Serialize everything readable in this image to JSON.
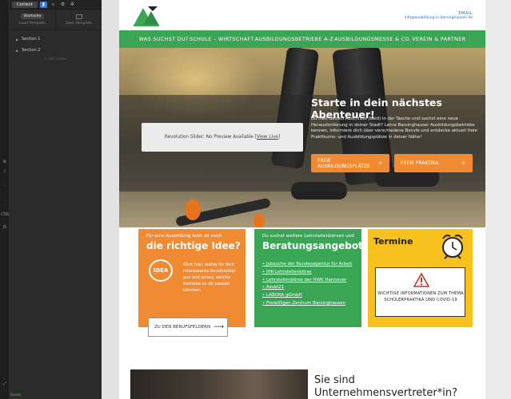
{
  "editor": {
    "tabs": [
      {
        "label": "Content"
      }
    ],
    "starter_label": "Startseite",
    "load_template": "Load Template",
    "save_template": "Save Template",
    "sections": [
      {
        "label": "Section 1"
      },
      {
        "label": "Section 2"
      }
    ],
    "add_section": "+ Add Section",
    "rail_labels": {
      "css": "CSS",
      "js": "JS"
    },
    "bottom_label": "Saves"
  },
  "site": {
    "email_label": "EMAIL",
    "email_value": "info@ausbildung-in-barsinghausen.de",
    "nav": [
      {
        "label": "WAS SUCHST DU?"
      },
      {
        "label": "SCHULE – WIRTSCHAFT"
      },
      {
        "label": "AUSBILDUNGSBETRIEBE A-Z"
      },
      {
        "label": "AUSBILDUNGSMESSE & CO."
      },
      {
        "label": "VEREIN & PARTNER"
      }
    ],
    "hero": {
      "title": "Starte in dein nächstes Abenteuer!",
      "body": "Du hast deinen Abschluss (bald) in der Tasche und suchst eine neue Herausforderung in deiner Stadt? Lerne Barsinghauser Ausbildungsbetriebe kennen, informiere dich über verschiedene Berufe und entdecke aktuell freie Praktikums- und Ausbildungsplätze in deiner Nähe!",
      "slider_text": "Revolution Slider: No Preview Available",
      "slider_link": "View Live",
      "btn_apprentice": "FREIE AUSBILDUNGSPLÄTZE",
      "btn_intern": "FREIE PRAKTIKA"
    },
    "card_orange": {
      "top": "Für eine Ausbildung fehlt dir noch",
      "big": "die richtige Idee?",
      "idea": "IDEA",
      "text": "Klick hier, wähle für dich interessante Berufsfelder aus und schau, welche Betriebe zu dir passen könnten.",
      "button": "ZU DEN BERUFSFELDERN"
    },
    "card_green": {
      "top": "Du suchst weitere Lehrstellenbörsen und",
      "big": "Beratungsangebote?",
      "links": [
        {
          "label": "Jobsuche der Bundesagentur für Arbeit"
        },
        {
          "label": "IHK-Lehrstellenbörse"
        },
        {
          "label": "Lehrstellenbörse der HWK Hannover"
        },
        {
          "label": "Azubi21"
        },
        {
          "label": "LABORA gGmbH"
        },
        {
          "label": "Freiwilligen Zentrum Barsinghausen"
        }
      ]
    },
    "card_yellow": {
      "title": "Termine",
      "box_text": "WICHTIGE INFORMATIONEN ZUM THEMA SCHÜLERPRAKTIKA UND COVID-19"
    },
    "bottom_title_1": "Sie sind",
    "bottom_title_2": "Unternehmensvertreter*in?"
  },
  "colors": {
    "green": "#3aa655",
    "orange": "#f08a33",
    "yellow": "#f7c21e",
    "link_blue": "#2a6ab8"
  }
}
